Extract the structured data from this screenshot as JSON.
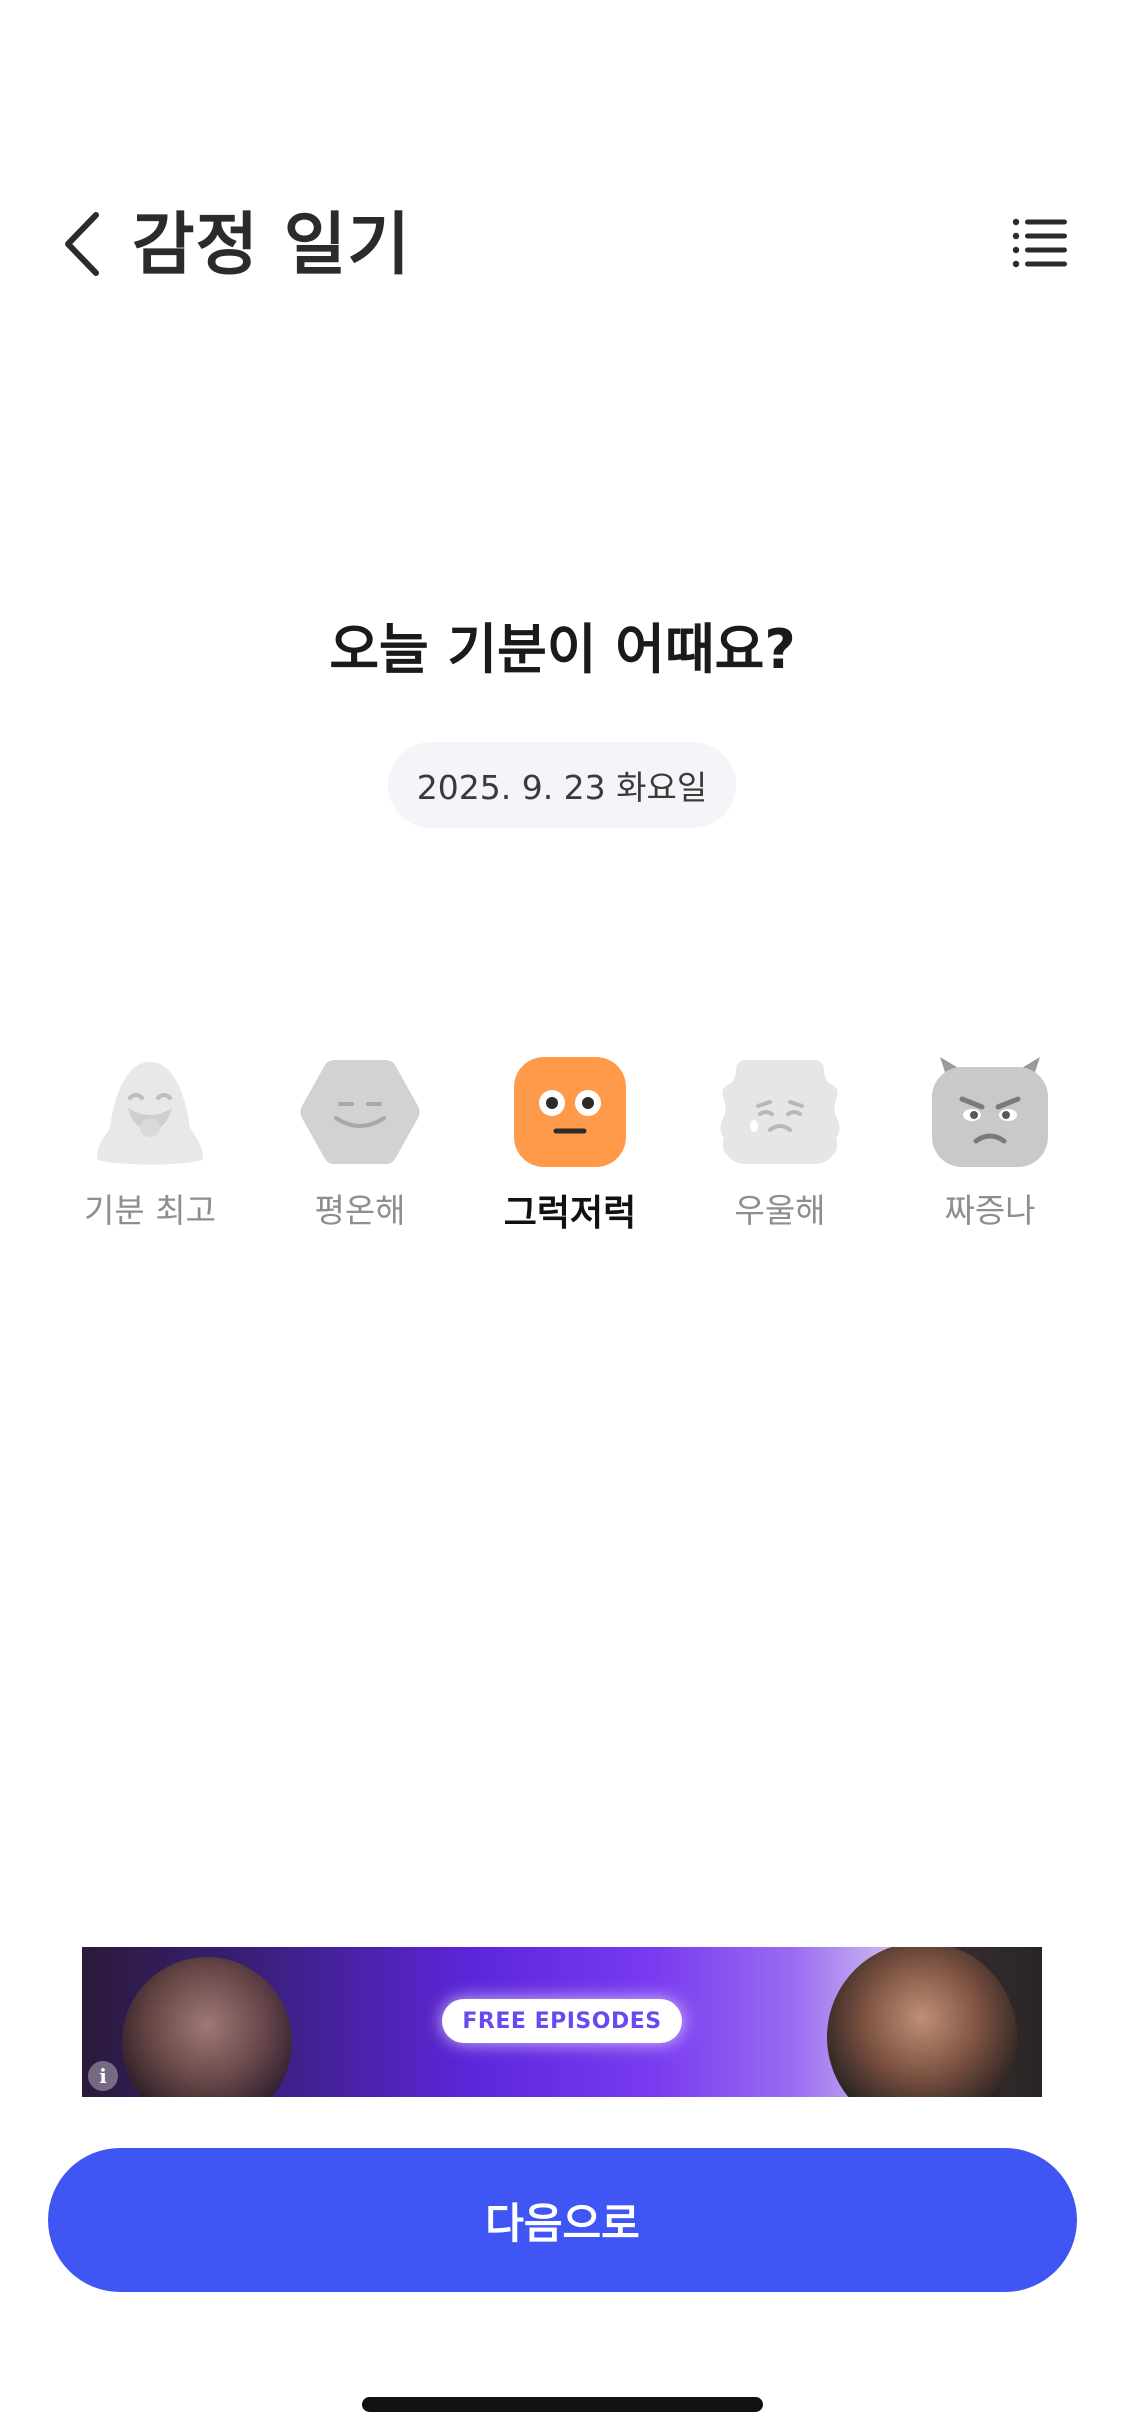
{
  "header": {
    "title": "감정 일기",
    "back_icon": "chevron-left-icon",
    "menu_icon": "list-menu-icon"
  },
  "main": {
    "question": "오늘 기분이 어때요?",
    "date": "2025. 9. 23 화요일"
  },
  "moods": [
    {
      "label": "기분 최고",
      "icon": "ghost-happy-face-icon",
      "selected": false
    },
    {
      "label": "평온해",
      "icon": "hexagon-calm-face-icon",
      "selected": false
    },
    {
      "label": "그럭저럭",
      "icon": "square-neutral-face-icon",
      "selected": true
    },
    {
      "label": "우울해",
      "icon": "cloud-sad-face-icon",
      "selected": false
    },
    {
      "label": "짜증나",
      "icon": "horned-angry-face-icon",
      "selected": false
    }
  ],
  "ad": {
    "cta": "FREE EPISODES",
    "info_icon": "info-icon"
  },
  "footer": {
    "next_label": "다음으로"
  },
  "colors": {
    "accent": "#3f55f4",
    "selected_mood": "#ff9a4a",
    "inactive_mood": "#e6e6e6",
    "inactive_mood_dark": "#cfcfcf"
  }
}
